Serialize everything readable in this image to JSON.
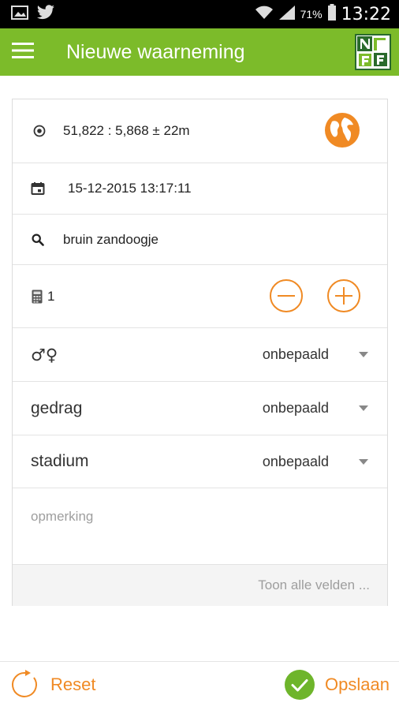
{
  "status_bar": {
    "battery_percent": "71%",
    "time": "13:22",
    "icons": [
      "image-icon",
      "twitter-icon",
      "wifi-icon",
      "signal-icon",
      "battery-icon"
    ]
  },
  "app_bar": {
    "title": "Nieuwe waarneming",
    "menu_icon": "menu-icon",
    "logo_icon": "ndff-logo"
  },
  "colors": {
    "brand_green": "#7cbb2a",
    "accent_orange": "#f08a24",
    "save_green": "#6eb52b"
  },
  "form": {
    "location": {
      "value": "51,822 : 5,868 ± 22m",
      "icon": "gps-target-icon",
      "action_icon": "globe-icon"
    },
    "datetime": {
      "value": "15-12-2015 13:17:11",
      "icon": "calendar-icon"
    },
    "species": {
      "value": "bruin zandoogje",
      "icon": "search-icon"
    },
    "count": {
      "value": "1",
      "icon": "calculator-icon",
      "decrement_icon": "minus-circle-icon",
      "increment_icon": "plus-circle-icon"
    },
    "sex": {
      "label": "♂♀",
      "value": "onbepaald"
    },
    "behaviour": {
      "label": "gedrag",
      "value": "onbepaald"
    },
    "stage": {
      "label": "stadium",
      "value": "onbepaald"
    },
    "remark": {
      "placeholder": "opmerking"
    },
    "show_all": "Toon alle velden ..."
  },
  "actions": {
    "reset_label": "Reset",
    "save_label": "Opslaan"
  }
}
